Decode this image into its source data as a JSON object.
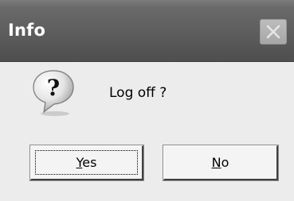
{
  "dialog": {
    "title": "Info",
    "message": "Log off ?",
    "icon": "question-icon",
    "close_icon": "close-icon",
    "buttons": {
      "yes": {
        "accel": "Y",
        "rest": "es"
      },
      "no": {
        "accel": "N",
        "rest": "o"
      }
    }
  }
}
